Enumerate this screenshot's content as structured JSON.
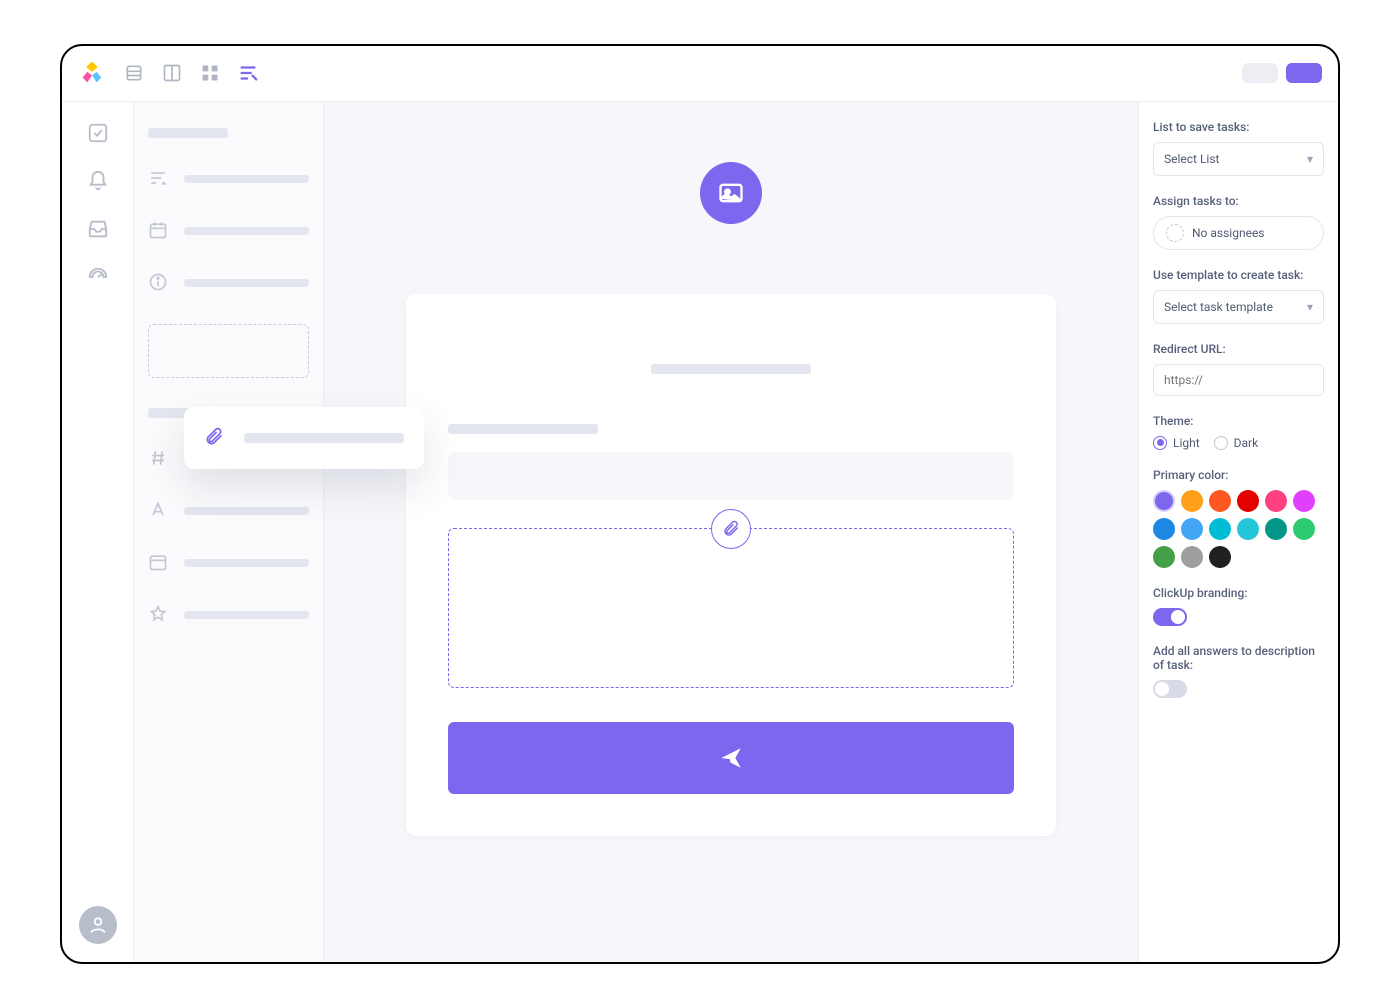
{
  "right_panel": {
    "list_label": "List to save tasks:",
    "list_select": "Select List",
    "assign_label": "Assign tasks to:",
    "assign_value": "No assignees",
    "template_label": "Use template to create task:",
    "template_select": "Select task template",
    "redirect_label": "Redirect URL:",
    "redirect_placeholder": "https://",
    "theme_label": "Theme:",
    "theme_light": "Light",
    "theme_dark": "Dark",
    "color_label": "Primary color:",
    "colors": [
      "#7b68ee",
      "#ff9f1a",
      "#ff5722",
      "#e50000",
      "#ff4081",
      "#e040fb",
      "#1e88e5",
      "#42a5f5",
      "#00bcd4",
      "#26c6da",
      "#009688",
      "#2ecc71",
      "#43a047",
      "#9e9e9e",
      "#212121"
    ],
    "selected_color_index": 0,
    "branding_label": "ClickUp branding:",
    "branding_on": true,
    "answers_label": "Add all answers to description of task:",
    "answers_on": false
  }
}
